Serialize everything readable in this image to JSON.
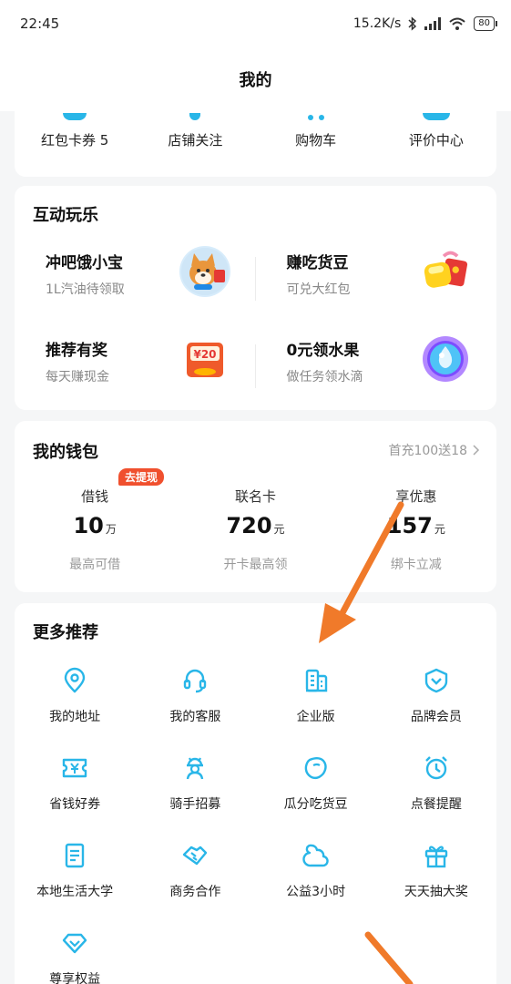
{
  "status_bar": {
    "time": "22:45",
    "speed": "15.2K/s",
    "battery": "80",
    "icons": [
      "bluetooth-icon",
      "signal-icon",
      "wifi-icon",
      "battery-icon"
    ]
  },
  "header": {
    "title": "我的"
  },
  "quick_row": {
    "items": [
      {
        "label": "红包卡券 5"
      },
      {
        "label": "店铺关注"
      },
      {
        "label": "购物车"
      },
      {
        "label": "评价中心"
      }
    ]
  },
  "fun": {
    "title": "互动玩乐",
    "items": [
      {
        "title": "冲吧饿小宝",
        "sub": "1L汽油待领取",
        "icon": "shiba-mascot-icon"
      },
      {
        "title": "赚吃货豆",
        "sub": "可兑大红包",
        "icon": "beans-redpacket-icon"
      },
      {
        "title": "推荐有奖",
        "sub": "每天赚现金",
        "icon": "coupon-20-icon",
        "icon_text": "¥20"
      },
      {
        "title": "0元领水果",
        "sub": "做任务领水滴",
        "icon": "water-drop-icon"
      }
    ]
  },
  "wallet": {
    "title": "我的钱包",
    "more": "首充100送18",
    "items": [
      {
        "label": "借钱",
        "value": "10",
        "unit": "万",
        "sub": "最高可借",
        "badge": "去提现"
      },
      {
        "label": "联名卡",
        "value": "720",
        "unit": "元",
        "sub": "开卡最高领"
      },
      {
        "label": "享优惠",
        "value": "157",
        "unit": "元",
        "sub": "绑卡立减"
      }
    ]
  },
  "more": {
    "title": "更多推荐",
    "items": [
      {
        "label": "我的地址",
        "icon": "location-pin-icon"
      },
      {
        "label": "我的客服",
        "icon": "headset-icon"
      },
      {
        "label": "企业版",
        "icon": "building-icon"
      },
      {
        "label": "品牌会员",
        "icon": "shield-chevron-icon"
      },
      {
        "label": "省钱好券",
        "icon": "yen-ticket-icon"
      },
      {
        "label": "骑手招募",
        "icon": "rider-icon"
      },
      {
        "label": "瓜分吃货豆",
        "icon": "bean-icon"
      },
      {
        "label": "点餐提醒",
        "icon": "alarm-clock-icon"
      },
      {
        "label": "本地生活大学",
        "icon": "document-icon"
      },
      {
        "label": "商务合作",
        "icon": "handshake-icon"
      },
      {
        "label": "公益3小时",
        "icon": "heart-outline-icon"
      },
      {
        "label": "天天抽大奖",
        "icon": "gift-icon"
      },
      {
        "label": "尊享权益",
        "icon": "diamond-icon"
      }
    ]
  },
  "colors": {
    "accent": "#29b6e8",
    "badge": "#f0502e",
    "arrow": "#f07a2a"
  }
}
